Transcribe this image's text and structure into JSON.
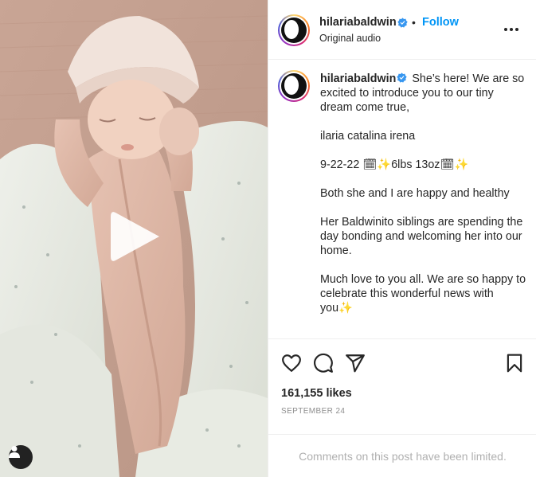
{
  "header": {
    "username": "hilariabaldwin",
    "separator": "•",
    "follow_label": "Follow",
    "audio": "Original audio",
    "icons": [
      "verified-badge-icon",
      "more-options-icon"
    ]
  },
  "caption": {
    "username": "hilariabaldwin",
    "line1": "She’s here! We are so excited to introduce you to our tiny dream come true,",
    "name": "ilaria catalina irena",
    "birth_date": "9-22-22",
    "weight": "6lbs 13oz",
    "health": "Both she and I are happy and healthy",
    "siblings": "Her Baldwinito siblings are spending the day bonding and welcoming her into our home.",
    "closing": "Much love to you all. We are so happy to celebrate this wonderful news with you",
    "sparkle": "✨"
  },
  "media": {
    "icons": [
      "play-icon",
      "user-tag-icon"
    ]
  },
  "actions": {
    "icons": [
      "like-heart-icon",
      "comment-icon",
      "share-icon",
      "save-bookmark-icon"
    ],
    "likes": "161,155 likes",
    "date": "SEPTEMBER 24"
  },
  "comments_limited": "Comments on this post have been limited.",
  "colors": {
    "link": "#0095f6",
    "verified": "#3897f0",
    "text": "#262626",
    "muted": "#8e8e8e",
    "border": "#efefef"
  }
}
